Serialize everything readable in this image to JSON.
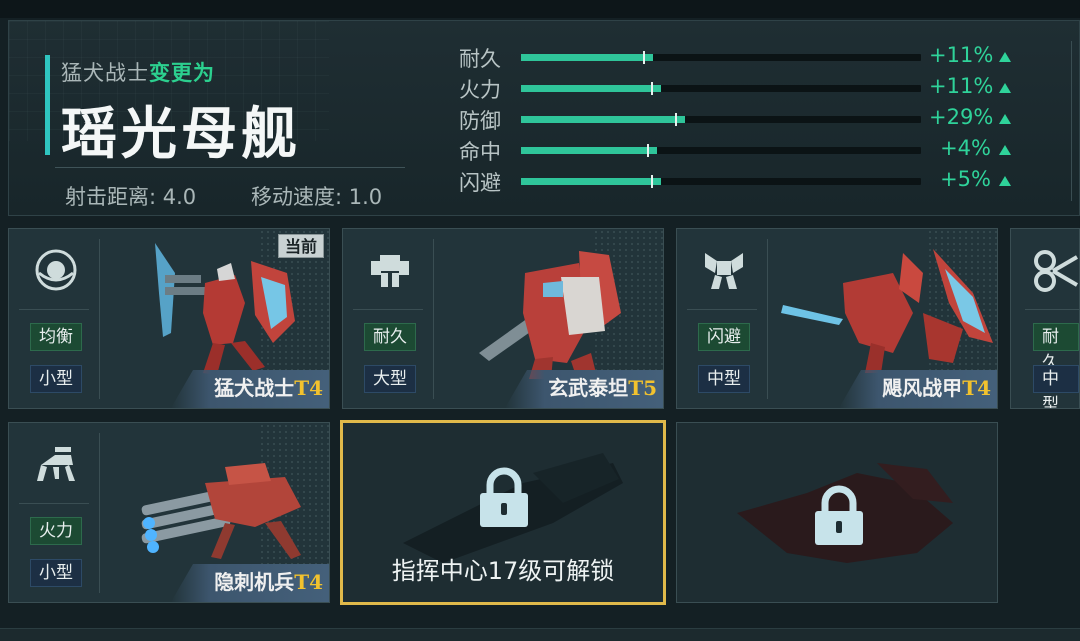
{
  "header": {
    "from_unit": "猛犬战士",
    "change_label": "变更为",
    "target_unit": "瑶光母舰",
    "range_label": "射击距离:",
    "range_value": "4.0",
    "speed_label": "移动速度:",
    "speed_value": "1.0",
    "attributes": [
      {
        "label": "耐久",
        "value": "+11%",
        "level": 0.33
      },
      {
        "label": "火力",
        "value": "+11%",
        "level": 0.35
      },
      {
        "label": "防御",
        "value": "+29%",
        "level": 0.41
      },
      {
        "label": "命中",
        "value": "+4%",
        "level": 0.34
      },
      {
        "label": "闪避",
        "value": "+5%",
        "level": 0.35
      }
    ],
    "accent_color": "#2fc5c0",
    "increase_color": "#2fd39a"
  },
  "cards": [
    {
      "role": "均衡",
      "size": "小型",
      "name": "猛犬战士",
      "tier": "T4",
      "badge": "当前",
      "icon": "balanced-role-icon"
    },
    {
      "role": "耐久",
      "size": "大型",
      "name": "玄武泰坦",
      "tier": "T5",
      "icon": "durability-role-icon"
    },
    {
      "role": "闪避",
      "size": "中型",
      "name": "飓风战甲",
      "tier": "T4",
      "icon": "evasion-role-icon"
    },
    {
      "role": "耐久",
      "size": "中型",
      "icon": "durability-role-icon-2"
    },
    {
      "role": "火力",
      "size": "小型",
      "name": "隐刺机兵",
      "tier": "T4",
      "icon": "firepower-role-icon"
    }
  ],
  "locked": {
    "unlock_text": "指挥中心17级可解锁",
    "selected_border_color": "#e0b94a"
  },
  "tier_color": "#f2c22e"
}
